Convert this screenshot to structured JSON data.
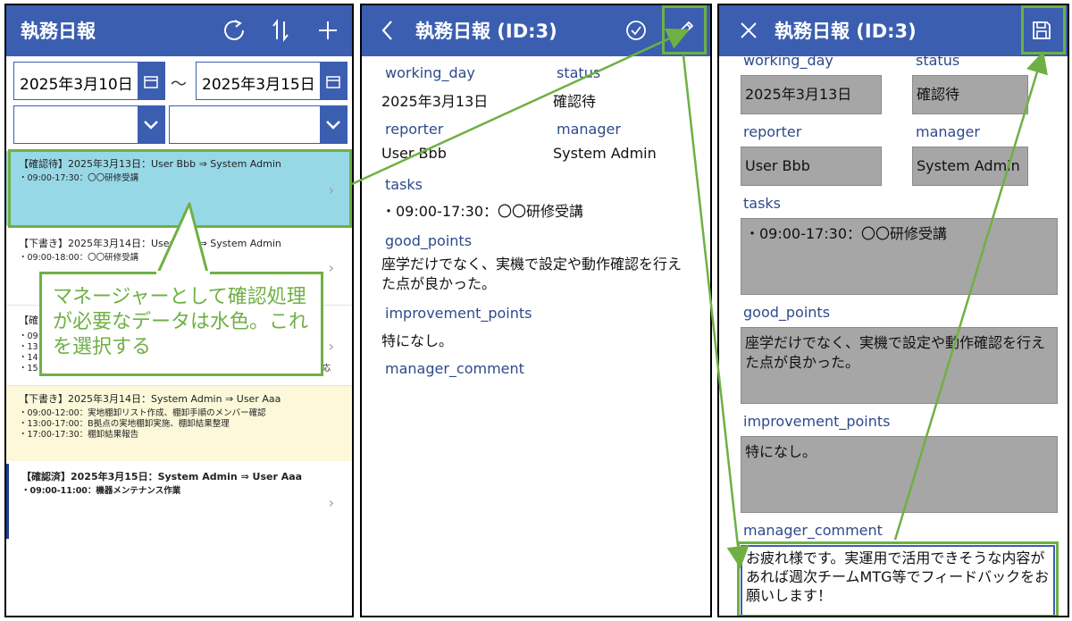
{
  "list_screen": {
    "title": "執務日報",
    "icons": [
      "refresh-icon",
      "sort-icon",
      "plus-icon"
    ],
    "date_from": "2025年3月10日",
    "range_sep": "～",
    "date_to": "2025年3月15日",
    "cards": [
      {
        "header": "【確認待】2025年3月13日：User Bbb ⇒ System Admin",
        "lines": [
          "・09:00-17:30：〇〇研修受講"
        ],
        "bg": "#97d8e6"
      },
      {
        "header": "【下書き】2025年3月14日：User Bbb ⇒ System Admin",
        "lines": [
          "・09:00-18:00：〇〇研修受講"
        ],
        "bg": "#ffffff"
      },
      {
        "header": "【確",
        "lines": [
          "・09",
          "・13",
          "・14",
          "・15"
        ],
        "trailing": "対応",
        "bg": "#ffffff"
      },
      {
        "header": "【下書き】2025年3月14日：System Admin ⇒ User Aaa",
        "lines": [
          "・09:00-12:00：実地棚卸リスト作成、棚卸手順のメンバー確認",
          "・13:00-17:00：B拠点の実地棚卸実施、棚卸結果整理",
          "・17:00-17:30：棚卸結果報告"
        ],
        "bg": "#fcf8d9"
      },
      {
        "header": "【確認済】2025年3月15日：System Admin ⇒ User Aaa",
        "lines": [
          "・09:00-11:00：機器メンテナンス作業"
        ],
        "bg": "#ffffff"
      }
    ],
    "callout": "マネージャーとして確認処理が必要なデータは水色。これを選択する"
  },
  "detail_screen": {
    "title": "執務日報 (ID:3)",
    "icons": [
      "back-icon",
      "check-circle-icon",
      "pencil-icon"
    ],
    "working_day_label": "working_day",
    "working_day": "2025年3月13日",
    "status_label": "status",
    "status": "確認待",
    "reporter_label": "reporter",
    "reporter": "User Bbb",
    "manager_label": "manager",
    "manager": "System Admin",
    "tasks_label": "tasks",
    "tasks": "・09:00-17:30：〇〇研修受講",
    "good_points_label": "good_points",
    "good_points": "座学だけでなく、実機で設定や動作確認を行えた点が良かった。",
    "improvement_points_label": "improvement_points",
    "improvement_points": "特になし。",
    "manager_comment_label": "manager_comment"
  },
  "edit_screen": {
    "title": "執務日報 (ID:3)",
    "icons": [
      "close-icon",
      "save-icon"
    ],
    "working_day_label": "working_day",
    "working_day": "2025年3月13日",
    "status_label": "status",
    "status": "確認待",
    "reporter_label": "reporter",
    "reporter": "User Bbb",
    "manager_label": "manager",
    "manager": "System Admin",
    "tasks_label": "tasks",
    "tasks": "・09:00-17:30：〇〇研修受講",
    "good_points_label": "good_points",
    "good_points": "座学だけでなく、実機で設定や動作確認を行えた点が良かった。",
    "improvement_points_label": "improvement_points",
    "improvement_points": "特になし。",
    "manager_comment_label": "manager_comment",
    "manager_comment": "お疲れ様です。実運用で活用できそうな内容があれば週次チームMTG等でフィードバックをお願いします！"
  },
  "colors": {
    "header": "#3b5eb0",
    "annotation": "#6fb044",
    "selected": "#97d8e6",
    "draft": "#fcf8d9",
    "readonly_field": "#a6a6a6"
  }
}
